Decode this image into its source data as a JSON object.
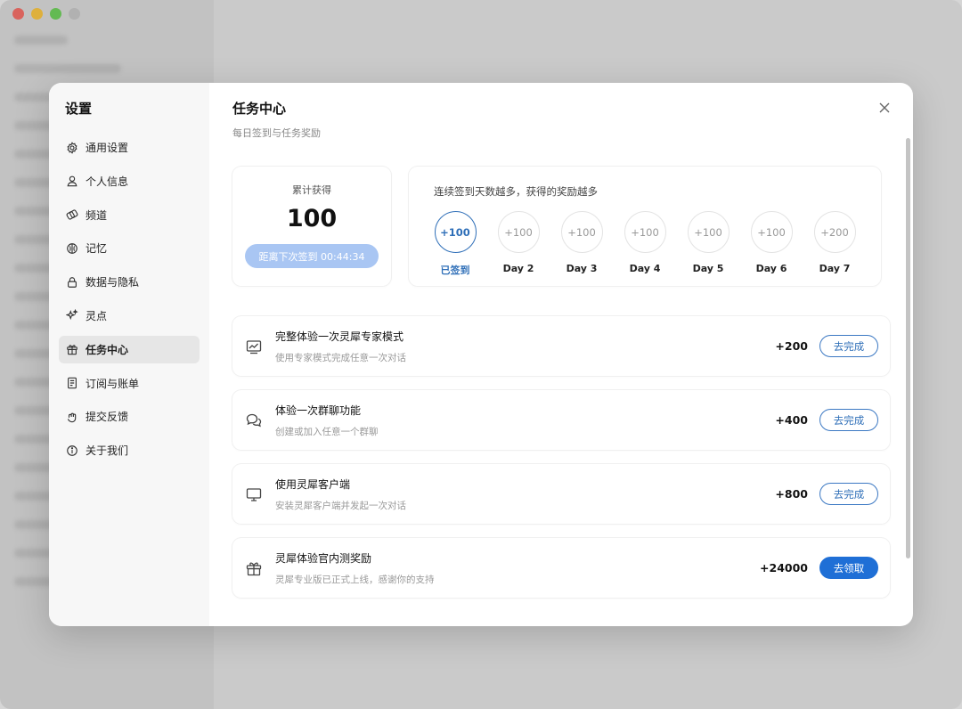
{
  "sidebar": {
    "title": "设置",
    "items": [
      {
        "label": "通用设置",
        "icon": "gear-icon"
      },
      {
        "label": "个人信息",
        "icon": "user-icon"
      },
      {
        "label": "频道",
        "icon": "channel-icon"
      },
      {
        "label": "记忆",
        "icon": "memory-icon"
      },
      {
        "label": "数据与隐私",
        "icon": "lock-icon"
      },
      {
        "label": "灵点",
        "icon": "sparkle-icon"
      },
      {
        "label": "任务中心",
        "icon": "gift-icon"
      },
      {
        "label": "订阅与账单",
        "icon": "receipt-icon"
      },
      {
        "label": "提交反馈",
        "icon": "feedback-icon"
      },
      {
        "label": "关于我们",
        "icon": "info-icon"
      }
    ],
    "active_index": 6
  },
  "header": {
    "title": "任务中心",
    "subtitle": "每日签到与任务奖励"
  },
  "total": {
    "label": "累计获得",
    "value": "100",
    "countdown": "距离下次签到 00:44:34"
  },
  "streak": {
    "title": "连续签到天数越多，获得的奖励越多",
    "days": [
      {
        "reward": "+100",
        "label": "已签到",
        "done": true
      },
      {
        "reward": "+100",
        "label": "Day 2",
        "done": false
      },
      {
        "reward": "+100",
        "label": "Day 3",
        "done": false
      },
      {
        "reward": "+100",
        "label": "Day 4",
        "done": false
      },
      {
        "reward": "+100",
        "label": "Day 5",
        "done": false
      },
      {
        "reward": "+100",
        "label": "Day 6",
        "done": false
      },
      {
        "reward": "+200",
        "label": "Day 7",
        "done": false
      }
    ]
  },
  "tasks": [
    {
      "title": "完整体验一次灵犀专家模式",
      "desc": "使用专家模式完成任意一次对话",
      "reward": "+200",
      "button": "去完成",
      "icon": "chart-icon"
    },
    {
      "title": "体验一次群聊功能",
      "desc": "创建或加入任意一个群聊",
      "reward": "+400",
      "button": "去完成",
      "icon": "chat-icon"
    },
    {
      "title": "使用灵犀客户端",
      "desc": "安装灵犀客户端并发起一次对话",
      "reward": "+800",
      "button": "去完成",
      "icon": "monitor-icon"
    },
    {
      "title": "灵犀体验官内测奖励",
      "desc": "灵犀专业版已正式上线，感谢你的支持",
      "reward": "+24000",
      "button": "去领取",
      "icon": "gift-icon"
    }
  ],
  "colors": {
    "accent": "#1f6fd6",
    "accent_text": "#2f6fb8",
    "countdown_bg": "#a9c6f3"
  }
}
